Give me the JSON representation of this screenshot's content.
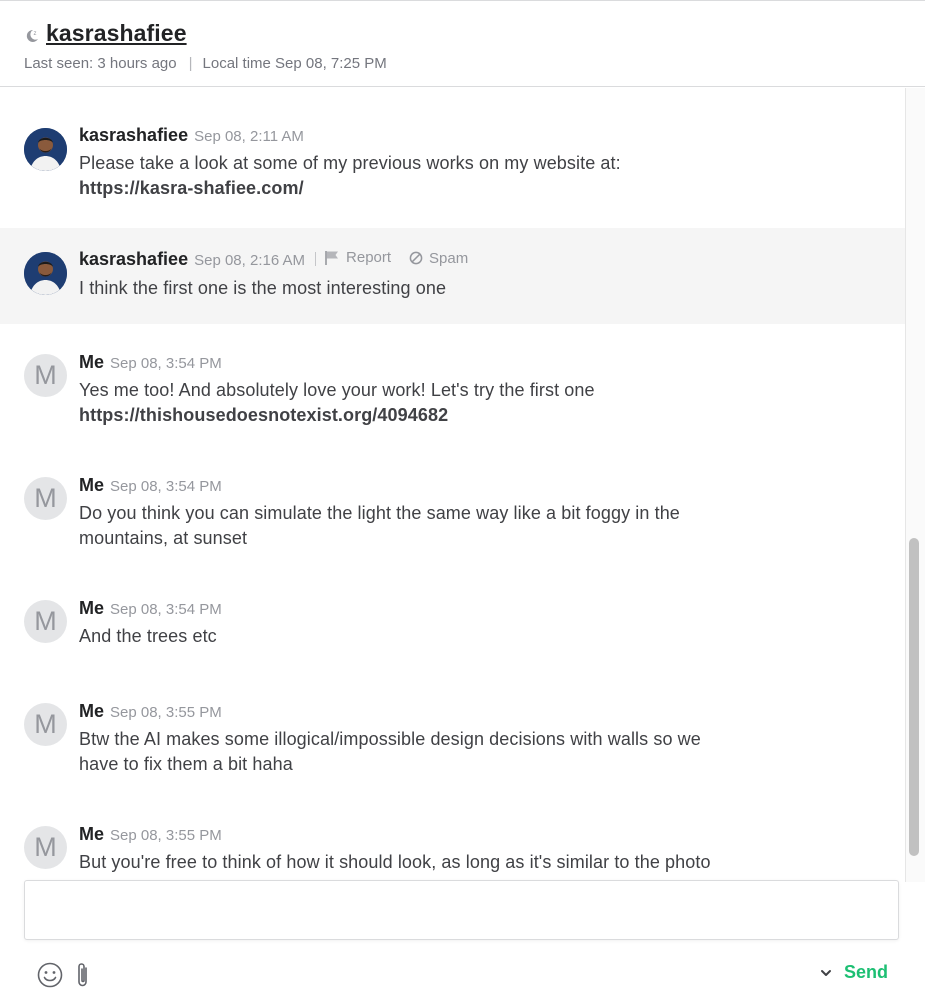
{
  "header": {
    "username": "kasrashafiee",
    "last_seen": "Last seen: 3 hours ago",
    "local_time": "Local time Sep 08, 7:25 PM",
    "status_icon": "away-moon-icon"
  },
  "messages": [
    {
      "sender": "kasrashafiee",
      "time": "Sep 08, 2:11 AM",
      "avatar": "photo",
      "lines": [
        "Please take a look at some of my previous works on my website at:"
      ],
      "link": "https://kasra-shafiee.com/"
    },
    {
      "sender": "kasrashafiee",
      "time": "Sep 08, 2:16 AM",
      "avatar": "photo",
      "highlighted": true,
      "actions": {
        "report": "Report",
        "spam": "Spam"
      },
      "lines": [
        "I think the first one is the most interesting one"
      ]
    },
    {
      "sender": "Me",
      "time": "Sep 08, 3:54 PM",
      "avatar_letter": "M",
      "lines": [
        "Yes me too! And absolutely love your work! Let's try the first one"
      ],
      "link": "https://thishousedoesnotexist.org/4094682"
    },
    {
      "sender": "Me",
      "time": "Sep 08, 3:54 PM",
      "avatar_letter": "M",
      "lines": [
        "Do you think you can simulate the light the same way like a bit foggy in the",
        "mountains, at sunset"
      ]
    },
    {
      "sender": "Me",
      "time": "Sep 08, 3:54 PM",
      "avatar_letter": "M",
      "lines": [
        "And the trees etc"
      ]
    },
    {
      "sender": "Me",
      "time": "Sep 08, 3:55 PM",
      "avatar_letter": "M",
      "lines": [
        "Btw the AI makes some illogical/impossible design decisions with walls so we",
        "have to fix them a bit haha"
      ]
    },
    {
      "sender": "Me",
      "time": "Sep 08, 3:55 PM",
      "avatar_letter": "M",
      "lines": [
        "But you're free to think of how it should look, as long as it's similar to the photo"
      ]
    }
  ],
  "composer": {
    "placeholder": "",
    "send_label": "Send",
    "emoji_icon": "smiley-icon",
    "attach_icon": "paperclip-icon"
  },
  "colors": {
    "accent": "#1dbf73",
    "text": "#404145",
    "muted": "#95979d",
    "highlight_row": "#f5f5f5"
  }
}
